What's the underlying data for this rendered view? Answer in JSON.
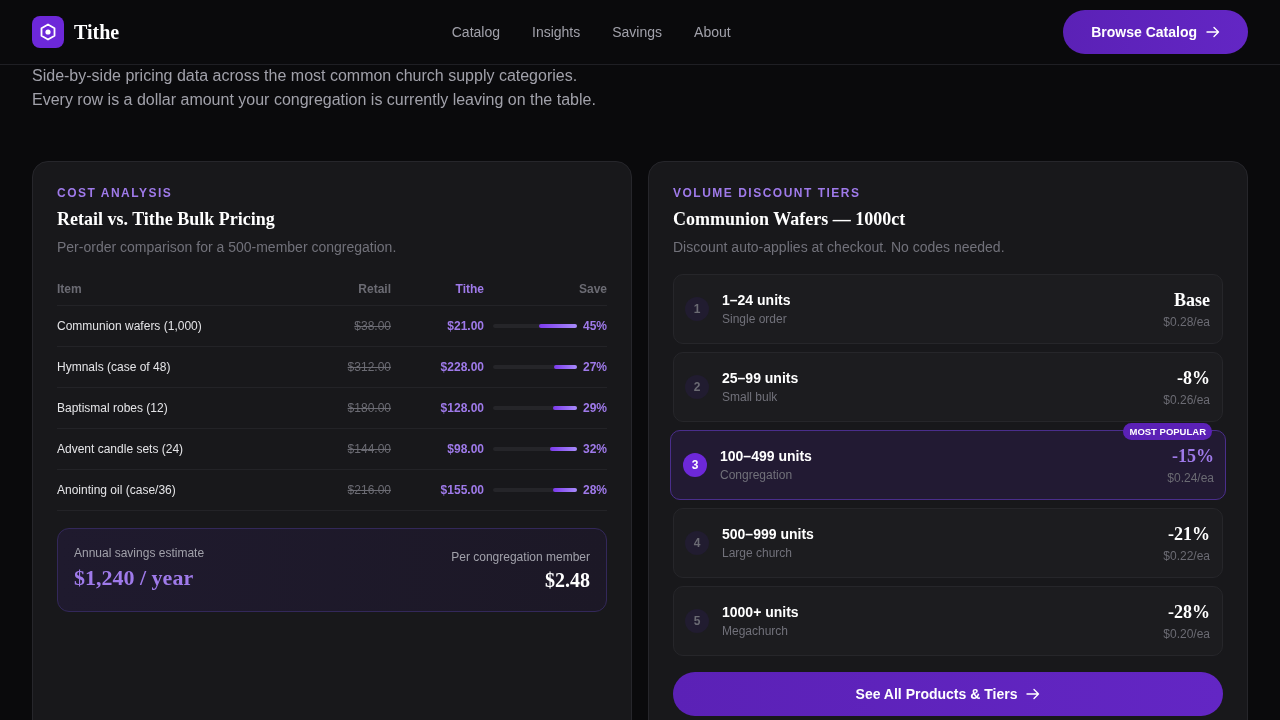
{
  "header": {
    "brand": "Tithe",
    "nav": [
      {
        "label": "Catalog"
      },
      {
        "label": "Insights"
      },
      {
        "label": "Savings"
      },
      {
        "label": "About"
      }
    ],
    "cta": "Browse Catalog"
  },
  "intro": "Side-by-side pricing data across the most common church supply categories. Every row is a dollar amount your congregation is currently leaving on the table.",
  "cost_analysis": {
    "eyebrow": "COST ANALYSIS",
    "title": "Retail vs. Tithe Bulk Pricing",
    "subtitle": "Per-order comparison for a 500-member congregation.",
    "columns": [
      {
        "label": "Item",
        "highlighted": false
      },
      {
        "label": "Retail",
        "highlighted": false
      },
      {
        "label": "Tithe",
        "highlighted": true
      },
      {
        "label": "Save",
        "highlighted": false
      }
    ],
    "rows": [
      {
        "item": "Communion wafers (1,000)",
        "retail": "$38.00",
        "tithe": "$21.00",
        "save": "45%",
        "level": 0.45
      },
      {
        "item": "Hymnals (case of 48)",
        "retail": "$312.00",
        "tithe": "$228.00",
        "save": "27%",
        "level": 0.27
      },
      {
        "item": "Baptismal robes (12)",
        "retail": "$180.00",
        "tithe": "$128.00",
        "save": "29%",
        "level": 0.29
      },
      {
        "item": "Advent candle sets (24)",
        "retail": "$144.00",
        "tithe": "$98.00",
        "save": "32%",
        "level": 0.32
      },
      {
        "item": "Anointing oil (case/36)",
        "retail": "$216.00",
        "tithe": "$155.00",
        "save": "28%",
        "level": 0.28
      }
    ],
    "summary": {
      "label": "Annual savings estimate",
      "value": "$1,240 / year",
      "per_label": "Per congregation member",
      "per_value": "$2.48"
    }
  },
  "volume_tiers": {
    "eyebrow": "VOLUME DISCOUNT TIERS",
    "title": "Communion Wafers — 1000ct",
    "subtitle": "Discount auto-applies at checkout. No codes needed.",
    "tiers": [
      {
        "number": "1",
        "range": "1–24 units",
        "name": "Single order",
        "discount": "Base",
        "price": "$0.28/ea",
        "highlighted": false
      },
      {
        "number": "2",
        "range": "25–99 units",
        "name": "Small bulk",
        "discount": "-8%",
        "price": "$0.26/ea",
        "highlighted": false
      },
      {
        "number": "3",
        "range": "100–499 units",
        "name": "Congregation",
        "discount": "-15%",
        "price": "$0.24/ea",
        "highlighted": true,
        "badge": "MOST POPULAR"
      },
      {
        "number": "4",
        "range": "500–999 units",
        "name": "Large church",
        "discount": "-21%",
        "price": "$0.22/ea",
        "highlighted": false
      },
      {
        "number": "5",
        "range": "1000+ units",
        "name": "Megachurch",
        "discount": "-28%",
        "price": "$0.20/ea",
        "highlighted": false
      }
    ],
    "cta": "See All Products & Tiers"
  }
}
